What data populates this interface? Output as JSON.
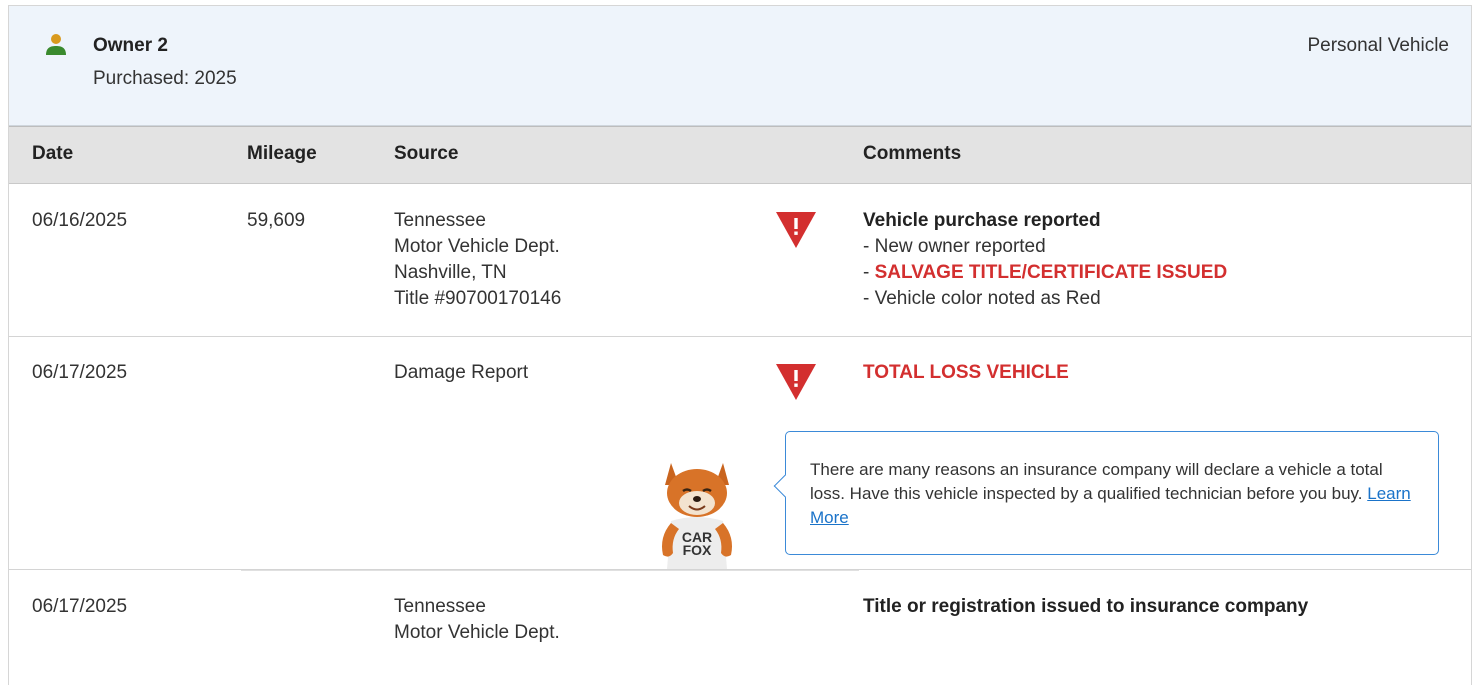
{
  "owner": {
    "title": "Owner 2",
    "purchased": "Purchased: 2025",
    "type": "Personal Vehicle"
  },
  "table": {
    "headers": {
      "date": "Date",
      "mileage": "Mileage",
      "source": "Source",
      "comments": "Comments"
    },
    "rows": [
      {
        "date": "06/16/2025",
        "mileage": "59,609",
        "source": [
          "Tennessee",
          "Motor Vehicle Dept.",
          "Nashville, TN",
          "Title #90700170146"
        ],
        "comment_title": "Vehicle purchase reported",
        "comment_lines": [
          "New owner reported",
          "SALVAGE TITLE/CERTIFICATE ISSUED",
          "Vehicle color noted as Red"
        ]
      },
      {
        "date": "06/17/2025",
        "mileage": "",
        "source": [
          "Damage Report"
        ],
        "comment_title": "TOTAL LOSS VEHICLE"
      },
      {
        "date": "06/17/2025",
        "mileage": "",
        "source": [
          "Tennessee",
          "Motor Vehicle Dept."
        ],
        "comment_title": "Title or registration issued to insurance company"
      }
    ]
  },
  "tooltip": {
    "text": "There are many reasons an insurance company will declare a vehicle a total loss. Have this vehicle inspected by a qualified technician before you buy.",
    "link": "Learn More"
  },
  "mascot": {
    "shirt_line1": "CAR",
    "shirt_line2": "FOX"
  },
  "colors": {
    "alert_red": "#d32f2f",
    "header_bg": "#eef4fb",
    "table_head_bg": "#e3e3e3",
    "link_blue": "#1a73c9",
    "tooltip_border": "#3b8ad8",
    "owner_icon_green": "#3a8a2e",
    "owner_icon_gold": "#d99a1e"
  }
}
